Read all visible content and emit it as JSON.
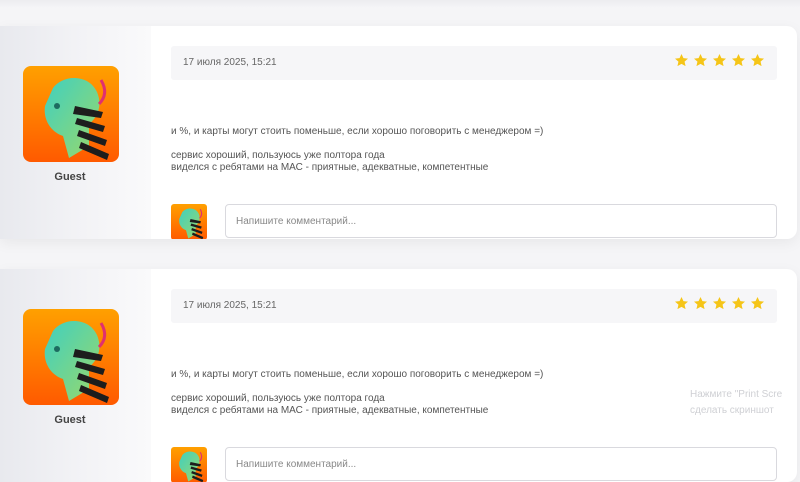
{
  "reviews": [
    {
      "author": "Guest",
      "date": "17 июля 2025, 15:21",
      "rating": 5,
      "rating_max": 5,
      "lines": [
        "и %, и карты могут стоить поменьше, если хорошо поговорить с менеджером =)",
        "сервис хороший, пользуюсь уже полтора года",
        "виделся с ребятами на МАС - приятные, адекватные, компетентные"
      ],
      "comment_placeholder": "Напишите комментарий..."
    },
    {
      "author": "Guest",
      "date": "17 июля 2025, 15:21",
      "rating": 5,
      "rating_max": 5,
      "lines": [
        "и %, и карты могут стоить поменьше, если хорошо поговорить с менеджером =)",
        "сервис хороший, пользуюсь уже полтора года",
        "виделся с ребятами на МАС - приятные, адекватные, компетентные"
      ],
      "comment_placeholder": "Напишите комментарий..."
    }
  ],
  "watermark": {
    "line1": "Нажмите \"Print Scre",
    "line2": "сделать скриншот"
  },
  "colors": {
    "star": "#f5c518",
    "avatar_bg": "#ff7a00"
  },
  "icons": {
    "avatar": "robot-head-avatar",
    "star": "star-icon"
  }
}
